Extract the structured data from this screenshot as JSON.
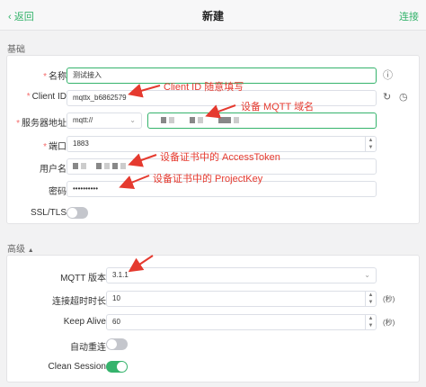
{
  "header": {
    "back_label": "返回",
    "title": "新建",
    "connect_label": "连接"
  },
  "basic": {
    "section_title": "基础",
    "name": {
      "label": "名称",
      "value": "测试接入"
    },
    "client_id": {
      "label": "Client ID",
      "value": "mqttx_b6862579"
    },
    "host": {
      "label": "服务器地址",
      "protocol": "mqtt://"
    },
    "port": {
      "label": "端口",
      "value": "1883"
    },
    "username": {
      "label": "用户名"
    },
    "password": {
      "label": "密码",
      "value": "••••••••••"
    },
    "ssl": {
      "label": "SSL/TLS",
      "on": false
    }
  },
  "advanced": {
    "section_title": "高级",
    "mqtt_version": {
      "label": "MQTT 版本",
      "value": "3.1.1"
    },
    "timeout": {
      "label": "连接超时时长",
      "value": "10",
      "unit": "(秒)"
    },
    "keep_alive": {
      "label": "Keep Alive",
      "value": "60",
      "unit": "(秒)"
    },
    "auto_reconnect": {
      "label": "自动重连",
      "on": false
    },
    "clean_session": {
      "label": "Clean Session",
      "on": true
    }
  },
  "annotations": {
    "client_id": "Client ID 随意填写",
    "domain": "设备 MQTT 域名",
    "access_token": "设备证书中的 AccessToken",
    "project_key": "设备证书中的 ProjectKey"
  },
  "colors": {
    "accent": "#35b36c",
    "annotation": "#e53a2f",
    "required": "#f56c6c"
  }
}
